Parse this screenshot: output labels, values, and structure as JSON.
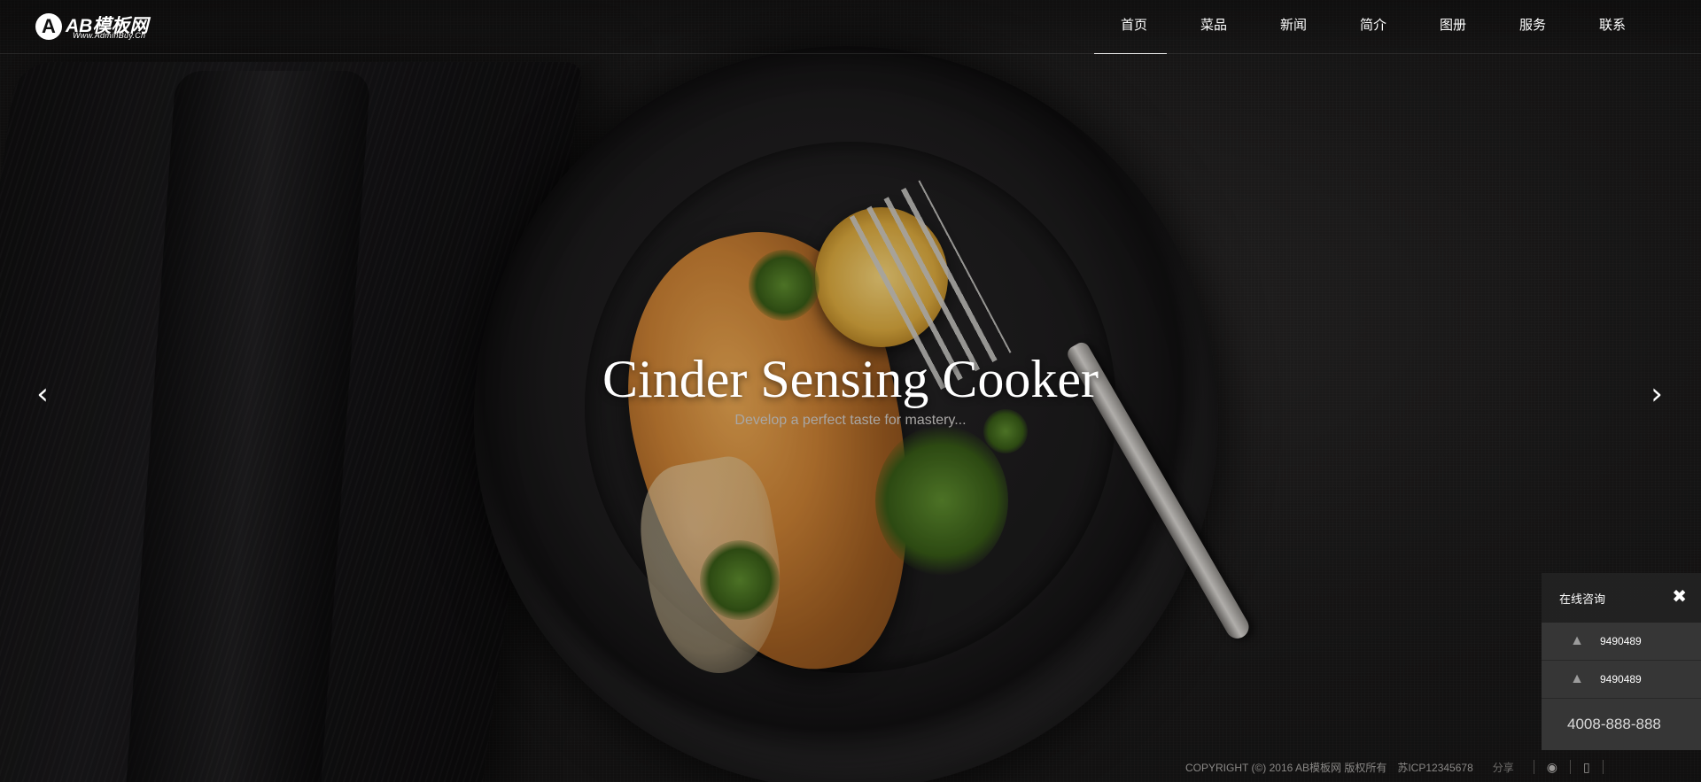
{
  "brand": {
    "mark": "A",
    "name": "AB模板网",
    "domain": "Www.AdminBuy.Cn"
  },
  "nav": {
    "items": [
      {
        "label": "首页",
        "active": true
      },
      {
        "label": "菜品",
        "active": false
      },
      {
        "label": "新闻",
        "active": false
      },
      {
        "label": "简介",
        "active": false
      },
      {
        "label": "图册",
        "active": false
      },
      {
        "label": "服务",
        "active": false
      },
      {
        "label": "联系",
        "active": false
      }
    ]
  },
  "slide": {
    "title": "Cinder Sensing Cooker",
    "subtitle": "Develop a perfect taste for mastery...",
    "prev_icon": "chevron-left-icon",
    "next_icon": "chevron-right-icon"
  },
  "consult": {
    "title": "在线咨询",
    "close_icon": "close-icon",
    "qq": [
      {
        "number": "9490489",
        "icon": "qq-icon"
      },
      {
        "number": "9490489",
        "icon": "qq-icon"
      }
    ],
    "phone": "4008-888-888"
  },
  "footer": {
    "copyright": "COPYRIGHT (©) 2016 AB模板网 版权所有",
    "icp": "苏ICP12345678",
    "share_label": "分享",
    "icons": [
      "weibo-icon",
      "mobile-icon"
    ]
  },
  "colors": {
    "text": "#ffffff",
    "subtitle": "#a9a7a5",
    "panel_head": "#232323",
    "panel_body": "#3a3a3a",
    "footer_text": "#8a8886"
  }
}
